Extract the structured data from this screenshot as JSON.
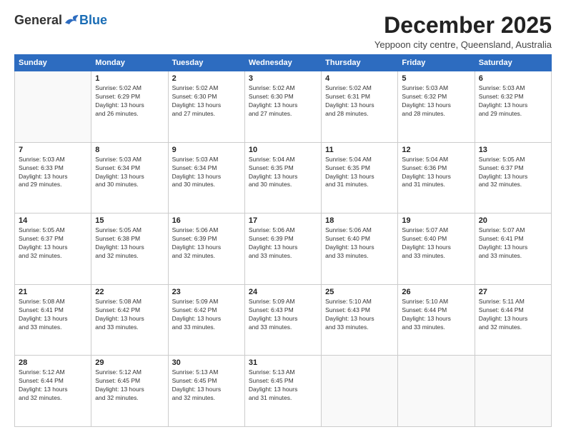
{
  "logo": {
    "general": "General",
    "blue": "Blue"
  },
  "title": "December 2025",
  "subtitle": "Yeppoon city centre, Queensland, Australia",
  "days_header": [
    "Sunday",
    "Monday",
    "Tuesday",
    "Wednesday",
    "Thursday",
    "Friday",
    "Saturday"
  ],
  "weeks": [
    [
      {
        "day": "",
        "info": ""
      },
      {
        "day": "1",
        "info": "Sunrise: 5:02 AM\nSunset: 6:29 PM\nDaylight: 13 hours\nand 26 minutes."
      },
      {
        "day": "2",
        "info": "Sunrise: 5:02 AM\nSunset: 6:30 PM\nDaylight: 13 hours\nand 27 minutes."
      },
      {
        "day": "3",
        "info": "Sunrise: 5:02 AM\nSunset: 6:30 PM\nDaylight: 13 hours\nand 27 minutes."
      },
      {
        "day": "4",
        "info": "Sunrise: 5:02 AM\nSunset: 6:31 PM\nDaylight: 13 hours\nand 28 minutes."
      },
      {
        "day": "5",
        "info": "Sunrise: 5:03 AM\nSunset: 6:32 PM\nDaylight: 13 hours\nand 28 minutes."
      },
      {
        "day": "6",
        "info": "Sunrise: 5:03 AM\nSunset: 6:32 PM\nDaylight: 13 hours\nand 29 minutes."
      }
    ],
    [
      {
        "day": "7",
        "info": "Sunrise: 5:03 AM\nSunset: 6:33 PM\nDaylight: 13 hours\nand 29 minutes."
      },
      {
        "day": "8",
        "info": "Sunrise: 5:03 AM\nSunset: 6:34 PM\nDaylight: 13 hours\nand 30 minutes."
      },
      {
        "day": "9",
        "info": "Sunrise: 5:03 AM\nSunset: 6:34 PM\nDaylight: 13 hours\nand 30 minutes."
      },
      {
        "day": "10",
        "info": "Sunrise: 5:04 AM\nSunset: 6:35 PM\nDaylight: 13 hours\nand 30 minutes."
      },
      {
        "day": "11",
        "info": "Sunrise: 5:04 AM\nSunset: 6:35 PM\nDaylight: 13 hours\nand 31 minutes."
      },
      {
        "day": "12",
        "info": "Sunrise: 5:04 AM\nSunset: 6:36 PM\nDaylight: 13 hours\nand 31 minutes."
      },
      {
        "day": "13",
        "info": "Sunrise: 5:05 AM\nSunset: 6:37 PM\nDaylight: 13 hours\nand 32 minutes."
      }
    ],
    [
      {
        "day": "14",
        "info": "Sunrise: 5:05 AM\nSunset: 6:37 PM\nDaylight: 13 hours\nand 32 minutes."
      },
      {
        "day": "15",
        "info": "Sunrise: 5:05 AM\nSunset: 6:38 PM\nDaylight: 13 hours\nand 32 minutes."
      },
      {
        "day": "16",
        "info": "Sunrise: 5:06 AM\nSunset: 6:39 PM\nDaylight: 13 hours\nand 32 minutes."
      },
      {
        "day": "17",
        "info": "Sunrise: 5:06 AM\nSunset: 6:39 PM\nDaylight: 13 hours\nand 33 minutes."
      },
      {
        "day": "18",
        "info": "Sunrise: 5:06 AM\nSunset: 6:40 PM\nDaylight: 13 hours\nand 33 minutes."
      },
      {
        "day": "19",
        "info": "Sunrise: 5:07 AM\nSunset: 6:40 PM\nDaylight: 13 hours\nand 33 minutes."
      },
      {
        "day": "20",
        "info": "Sunrise: 5:07 AM\nSunset: 6:41 PM\nDaylight: 13 hours\nand 33 minutes."
      }
    ],
    [
      {
        "day": "21",
        "info": "Sunrise: 5:08 AM\nSunset: 6:41 PM\nDaylight: 13 hours\nand 33 minutes."
      },
      {
        "day": "22",
        "info": "Sunrise: 5:08 AM\nSunset: 6:42 PM\nDaylight: 13 hours\nand 33 minutes."
      },
      {
        "day": "23",
        "info": "Sunrise: 5:09 AM\nSunset: 6:42 PM\nDaylight: 13 hours\nand 33 minutes."
      },
      {
        "day": "24",
        "info": "Sunrise: 5:09 AM\nSunset: 6:43 PM\nDaylight: 13 hours\nand 33 minutes."
      },
      {
        "day": "25",
        "info": "Sunrise: 5:10 AM\nSunset: 6:43 PM\nDaylight: 13 hours\nand 33 minutes."
      },
      {
        "day": "26",
        "info": "Sunrise: 5:10 AM\nSunset: 6:44 PM\nDaylight: 13 hours\nand 33 minutes."
      },
      {
        "day": "27",
        "info": "Sunrise: 5:11 AM\nSunset: 6:44 PM\nDaylight: 13 hours\nand 32 minutes."
      }
    ],
    [
      {
        "day": "28",
        "info": "Sunrise: 5:12 AM\nSunset: 6:44 PM\nDaylight: 13 hours\nand 32 minutes."
      },
      {
        "day": "29",
        "info": "Sunrise: 5:12 AM\nSunset: 6:45 PM\nDaylight: 13 hours\nand 32 minutes."
      },
      {
        "day": "30",
        "info": "Sunrise: 5:13 AM\nSunset: 6:45 PM\nDaylight: 13 hours\nand 32 minutes."
      },
      {
        "day": "31",
        "info": "Sunrise: 5:13 AM\nSunset: 6:45 PM\nDaylight: 13 hours\nand 31 minutes."
      },
      {
        "day": "",
        "info": ""
      },
      {
        "day": "",
        "info": ""
      },
      {
        "day": "",
        "info": ""
      }
    ]
  ]
}
